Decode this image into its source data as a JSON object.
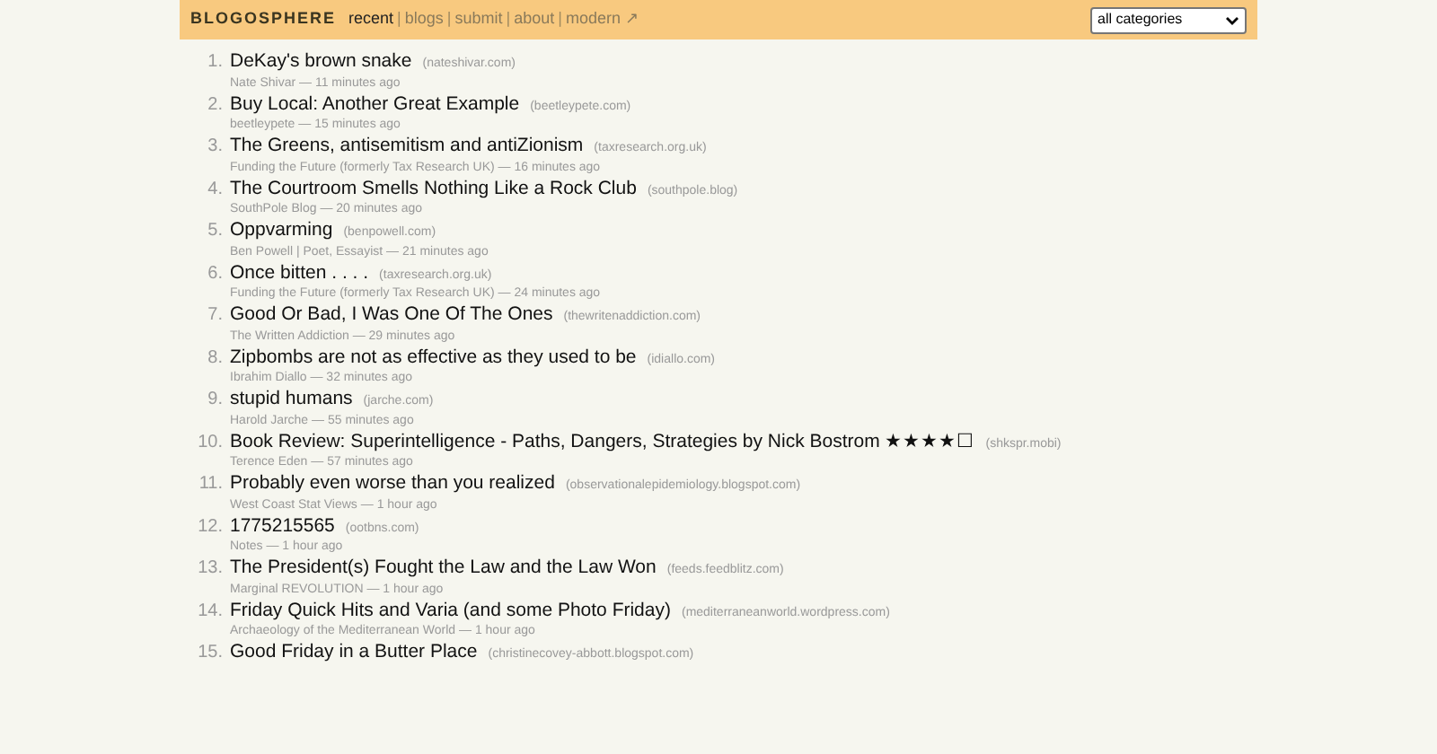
{
  "header": {
    "brand": "BLOGOSPHERE",
    "nav": [
      {
        "label": "recent",
        "selected": true
      },
      {
        "label": "blogs",
        "selected": false
      },
      {
        "label": "submit",
        "selected": false
      },
      {
        "label": "about",
        "selected": false
      },
      {
        "label": "modern ↗",
        "selected": false
      }
    ],
    "separator": "|",
    "category_select": "all categories"
  },
  "items": [
    {
      "rank": "1.",
      "title": "DeKay's brown snake",
      "domain": "(nateshivar.com)",
      "meta": "Nate Shivar — 11 minutes ago"
    },
    {
      "rank": "2.",
      "title": "Buy Local: Another Great Example",
      "domain": "(beetleypete.com)",
      "meta": "beetleypete — 15 minutes ago"
    },
    {
      "rank": "3.",
      "title": "The Greens, antisemitism and antiZionism",
      "domain": "(taxresearch.org.uk)",
      "meta": "Funding the Future (formerly Tax Research UK) — 16 minutes ago"
    },
    {
      "rank": "4.",
      "title": "The Courtroom Smells Nothing Like a Rock Club",
      "domain": "(southpole.blog)",
      "meta": "SouthPole Blog — 20 minutes ago"
    },
    {
      "rank": "5.",
      "title": "Oppvarming",
      "domain": "(benpowell.com)",
      "meta": "Ben Powell | Poet, Essayist — 21 minutes ago"
    },
    {
      "rank": "6.",
      "title": "Once bitten . . . .",
      "domain": "(taxresearch.org.uk)",
      "meta": "Funding the Future (formerly Tax Research UK) — 24 minutes ago"
    },
    {
      "rank": "7.",
      "title": "Good Or Bad, I Was One Of The Ones",
      "domain": "(thewritenaddiction.com)",
      "meta": "The Written Addiction — 29 minutes ago"
    },
    {
      "rank": "8.",
      "title": "Zipbombs are not as effective as they used to be",
      "domain": "(idiallo.com)",
      "meta": "Ibrahim Diallo — 32 minutes ago"
    },
    {
      "rank": "9.",
      "title": "stupid humans",
      "domain": "(jarche.com)",
      "meta": "Harold Jarche — 55 minutes ago"
    },
    {
      "rank": "10.",
      "title": "Book Review: Superintelligence - Paths, Dangers, Strategies by Nick Bostrom ★★★★☐",
      "domain": "(shkspr.mobi)",
      "meta": "Terence Eden — 57 minutes ago"
    },
    {
      "rank": "11.",
      "title": "Probably even worse than you realized",
      "domain": "(observationalepidemiology.blogspot.com)",
      "meta": "West Coast Stat Views — 1 hour ago"
    },
    {
      "rank": "12.",
      "title": "1775215565",
      "domain": "(ootbns.com)",
      "meta": "Notes — 1 hour ago"
    },
    {
      "rank": "13.",
      "title": "The President(s) Fought the Law and the Law Won",
      "domain": "(feeds.feedblitz.com)",
      "meta": "Marginal REVOLUTION — 1 hour ago"
    },
    {
      "rank": "14.",
      "title": "Friday Quick Hits and Varia (and some Photo Friday)",
      "domain": "(mediterraneanworld.wordpress.com)",
      "meta": "Archaeology of the Mediterranean World — 1 hour ago"
    },
    {
      "rank": "15.",
      "title": "Good Friday in a Butter Place",
      "domain": "(christinecovey-abbott.blogspot.com)"
    }
  ]
}
